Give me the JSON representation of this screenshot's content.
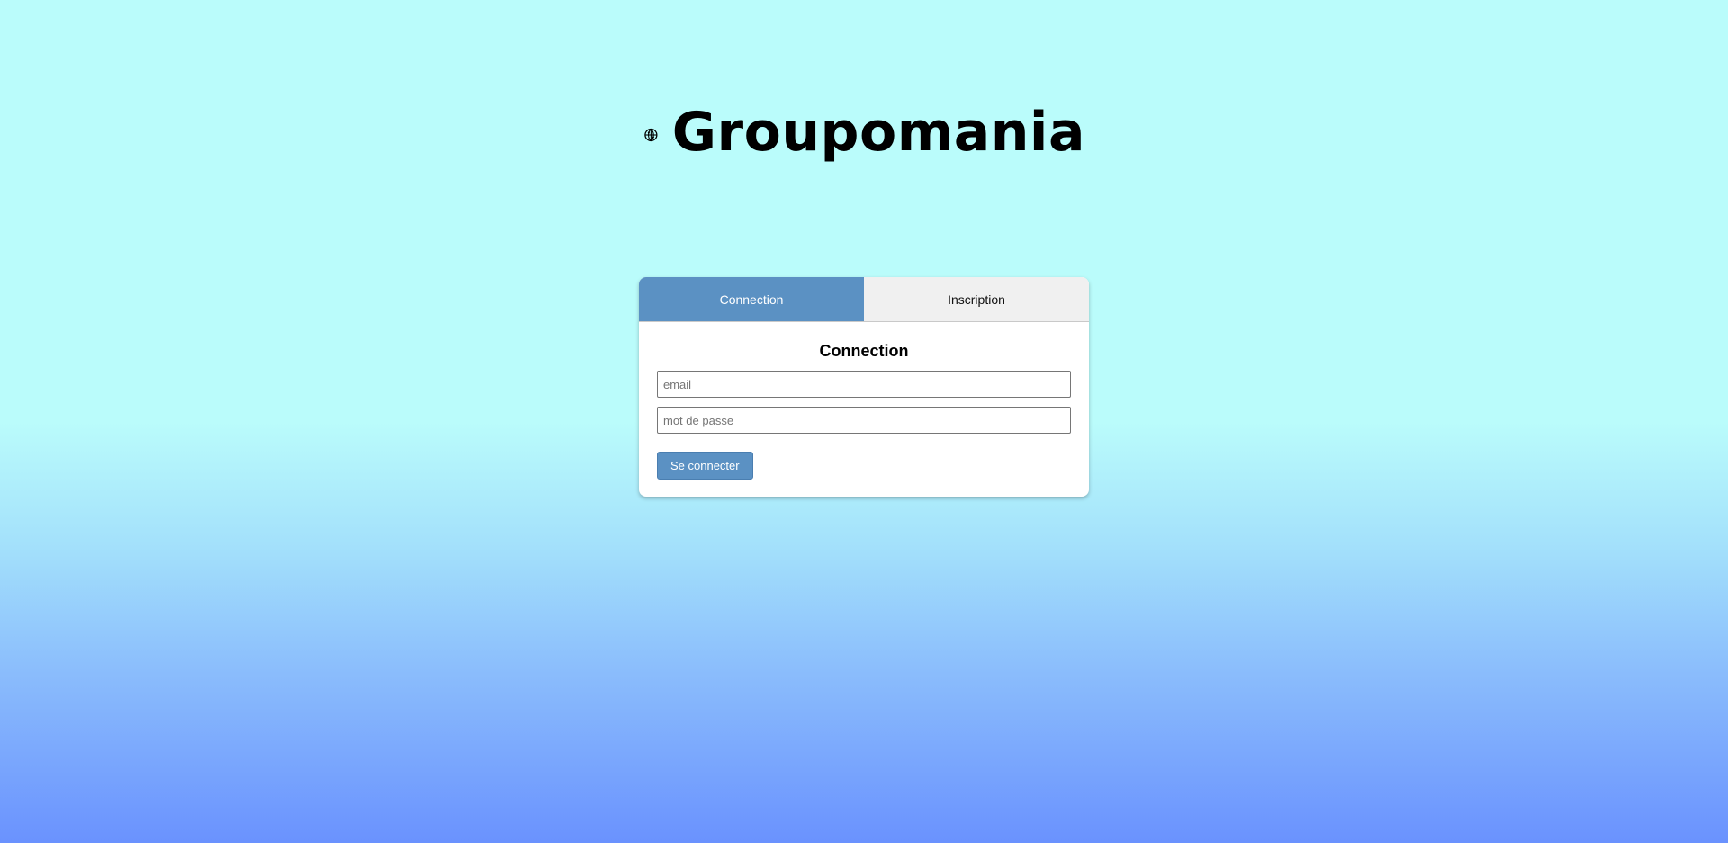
{
  "brand": {
    "icon": "globe-icon",
    "name": "Groupomania"
  },
  "tabs": [
    {
      "label": "Connection",
      "active": true
    },
    {
      "label": "Inscription",
      "active": false
    }
  ],
  "form": {
    "title": "Connection",
    "email_placeholder": "email",
    "password_placeholder": "mot de passe",
    "email_value": "",
    "password_value": "",
    "submit_label": "Se connecter"
  },
  "colors": {
    "accent": "#5b91c3",
    "inactive_tab": "#f0f0f0",
    "background_top": "#bafcfb",
    "background_bottom": "#6a92fe"
  }
}
